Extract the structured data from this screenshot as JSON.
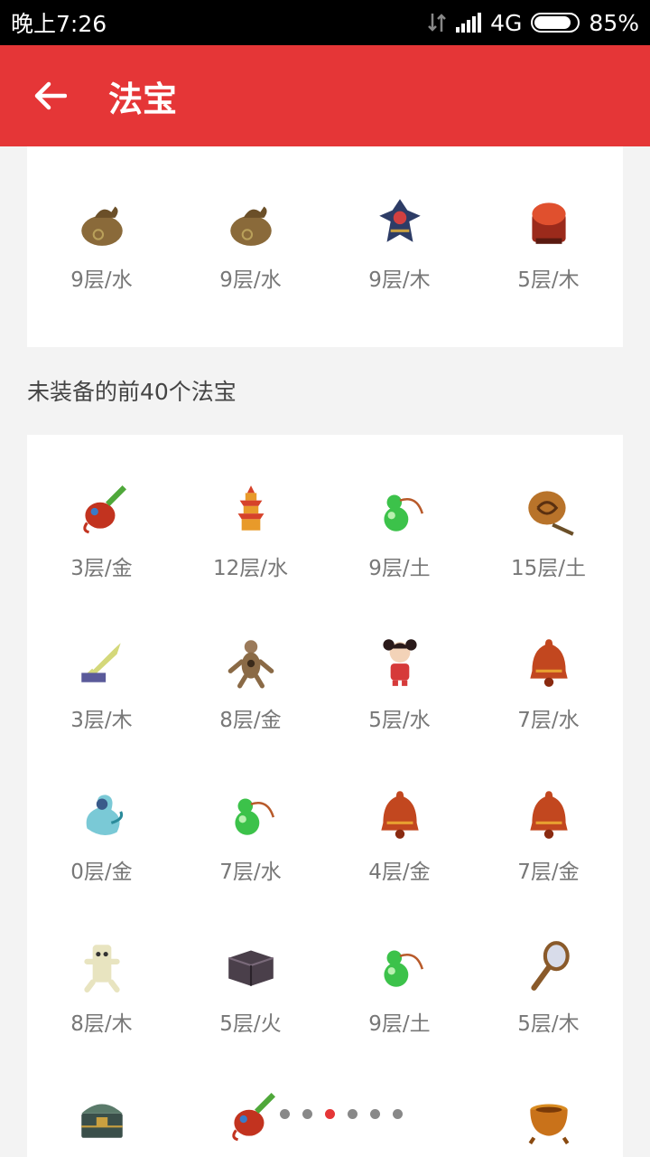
{
  "status": {
    "time": "晚上7:26",
    "network": "4G",
    "battery": "85%"
  },
  "app": {
    "title": "法宝"
  },
  "equipped": [
    {
      "label": "9层/水",
      "icon": "bag-icon"
    },
    {
      "label": "9层/水",
      "icon": "bag-icon"
    },
    {
      "label": "9层/木",
      "icon": "warrior-icon"
    },
    {
      "label": "5层/木",
      "icon": "drum-icon"
    }
  ],
  "section": {
    "label": "未装备的前40个法宝"
  },
  "unequipped": [
    {
      "label": "3层/金",
      "icon": "beetle-icon"
    },
    {
      "label": "12层/水",
      "icon": "pagoda-icon"
    },
    {
      "label": "9层/土",
      "icon": "gourd-icon"
    },
    {
      "label": "15层/土",
      "icon": "scroll-drum-icon"
    },
    {
      "label": "3层/木",
      "icon": "feather-blade-icon"
    },
    {
      "label": "8层/金",
      "icon": "puppet-icon"
    },
    {
      "label": "5层/水",
      "icon": "doll-icon"
    },
    {
      "label": "7层/水",
      "icon": "bell-icon"
    },
    {
      "label": "0层/金",
      "icon": "spirit-icon"
    },
    {
      "label": "7层/水",
      "icon": "gourd-icon"
    },
    {
      "label": "4层/金",
      "icon": "bell-icon"
    },
    {
      "label": "7层/金",
      "icon": "bell-icon"
    },
    {
      "label": "8层/木",
      "icon": "ghost-icon"
    },
    {
      "label": "5层/火",
      "icon": "box-icon"
    },
    {
      "label": "9层/土",
      "icon": "gourd-icon"
    },
    {
      "label": "5层/木",
      "icon": "mirror-icon"
    },
    {
      "label": "",
      "icon": "chest-icon"
    },
    {
      "label": "",
      "icon": "beetle-icon"
    },
    {
      "label": "",
      "icon": "hidden"
    },
    {
      "label": "",
      "icon": "pot-icon"
    }
  ],
  "pager": {
    "count": 6,
    "active_index": 2
  },
  "colors": {
    "accent": "#e53637",
    "text": "#777777"
  }
}
